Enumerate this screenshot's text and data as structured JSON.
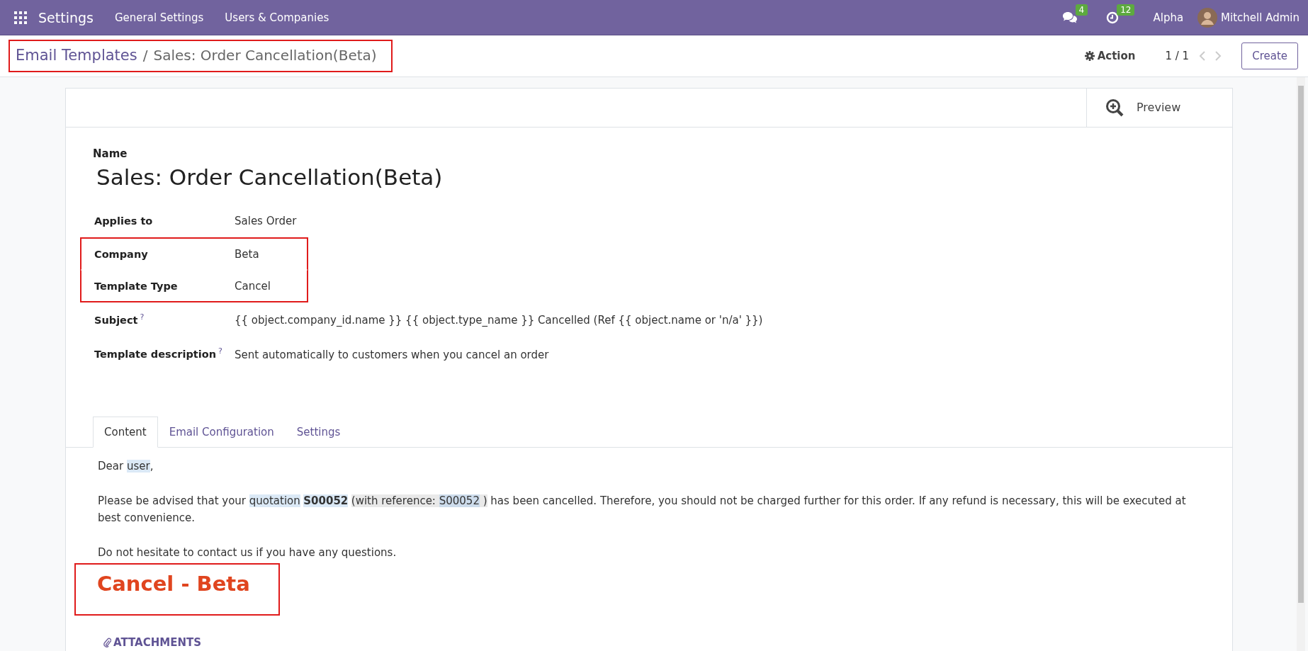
{
  "navbar": {
    "app_name": "Settings",
    "menu": [
      "General Settings",
      "Users & Companies"
    ],
    "messages_badge": "4",
    "activities_badge": "12",
    "company": "Alpha",
    "user": "Mitchell Admin"
  },
  "breadcrumb": {
    "parent": "Email Templates",
    "separator": "/",
    "current": "Sales: Order Cancellation(Beta)",
    "highlighted": true
  },
  "control_panel": {
    "action": "Action",
    "pager": "1 / 1",
    "create": "Create"
  },
  "button_box": {
    "preview": "Preview"
  },
  "form": {
    "name_label": "Name",
    "name": "Sales: Order Cancellation(Beta)",
    "fields": [
      {
        "label": "Applies to",
        "value": "Sales Order",
        "help": false,
        "highlighted": false
      },
      {
        "label": "Company",
        "value": "Beta",
        "help": false,
        "highlighted": true
      },
      {
        "label": "Template Type",
        "value": "Cancel",
        "help": false,
        "highlighted": true
      },
      {
        "label": "Subject",
        "value": "{{ object.company_id.name }} {{ object.type_name }} Cancelled (Ref {{ object.name or 'n/a' }})",
        "help": true,
        "highlighted": false
      },
      {
        "label": "Template description",
        "value": "Sent automatically to customers when you cancel an order",
        "help": true,
        "highlighted": false
      }
    ],
    "help_mark": "?"
  },
  "tabs": [
    {
      "label": "Content",
      "selected": true
    },
    {
      "label": "Email Configuration",
      "selected": false
    },
    {
      "label": "Settings",
      "selected": false
    }
  ],
  "content": {
    "greeting": [
      {
        "text": "Dear ",
        "kind": "plain"
      },
      {
        "text": "user",
        "kind": "field"
      },
      {
        "text": ",",
        "kind": "plain"
      }
    ],
    "paragraph": [
      {
        "text": "Please be advised that your ",
        "kind": "plain"
      },
      {
        "text": "quotation",
        "kind": "field"
      },
      {
        "text": "S00052",
        "kind": "field-bold"
      },
      {
        "text": "(with reference: ",
        "kind": "ref"
      },
      {
        "text": "S00052",
        "kind": "ref-field"
      },
      {
        "text": " )",
        "kind": "ref"
      },
      {
        "text": " has been cancelled. Therefore, you should not be charged further for this order. If any refund is necessary, this will be executed at best convenience.",
        "kind": "plain"
      }
    ],
    "closing": "Do not hesitate to contact us if you have any questions.",
    "heading": "Cancel - Beta",
    "heading_highlighted": true,
    "attachments": "ATTACHMENTS"
  }
}
